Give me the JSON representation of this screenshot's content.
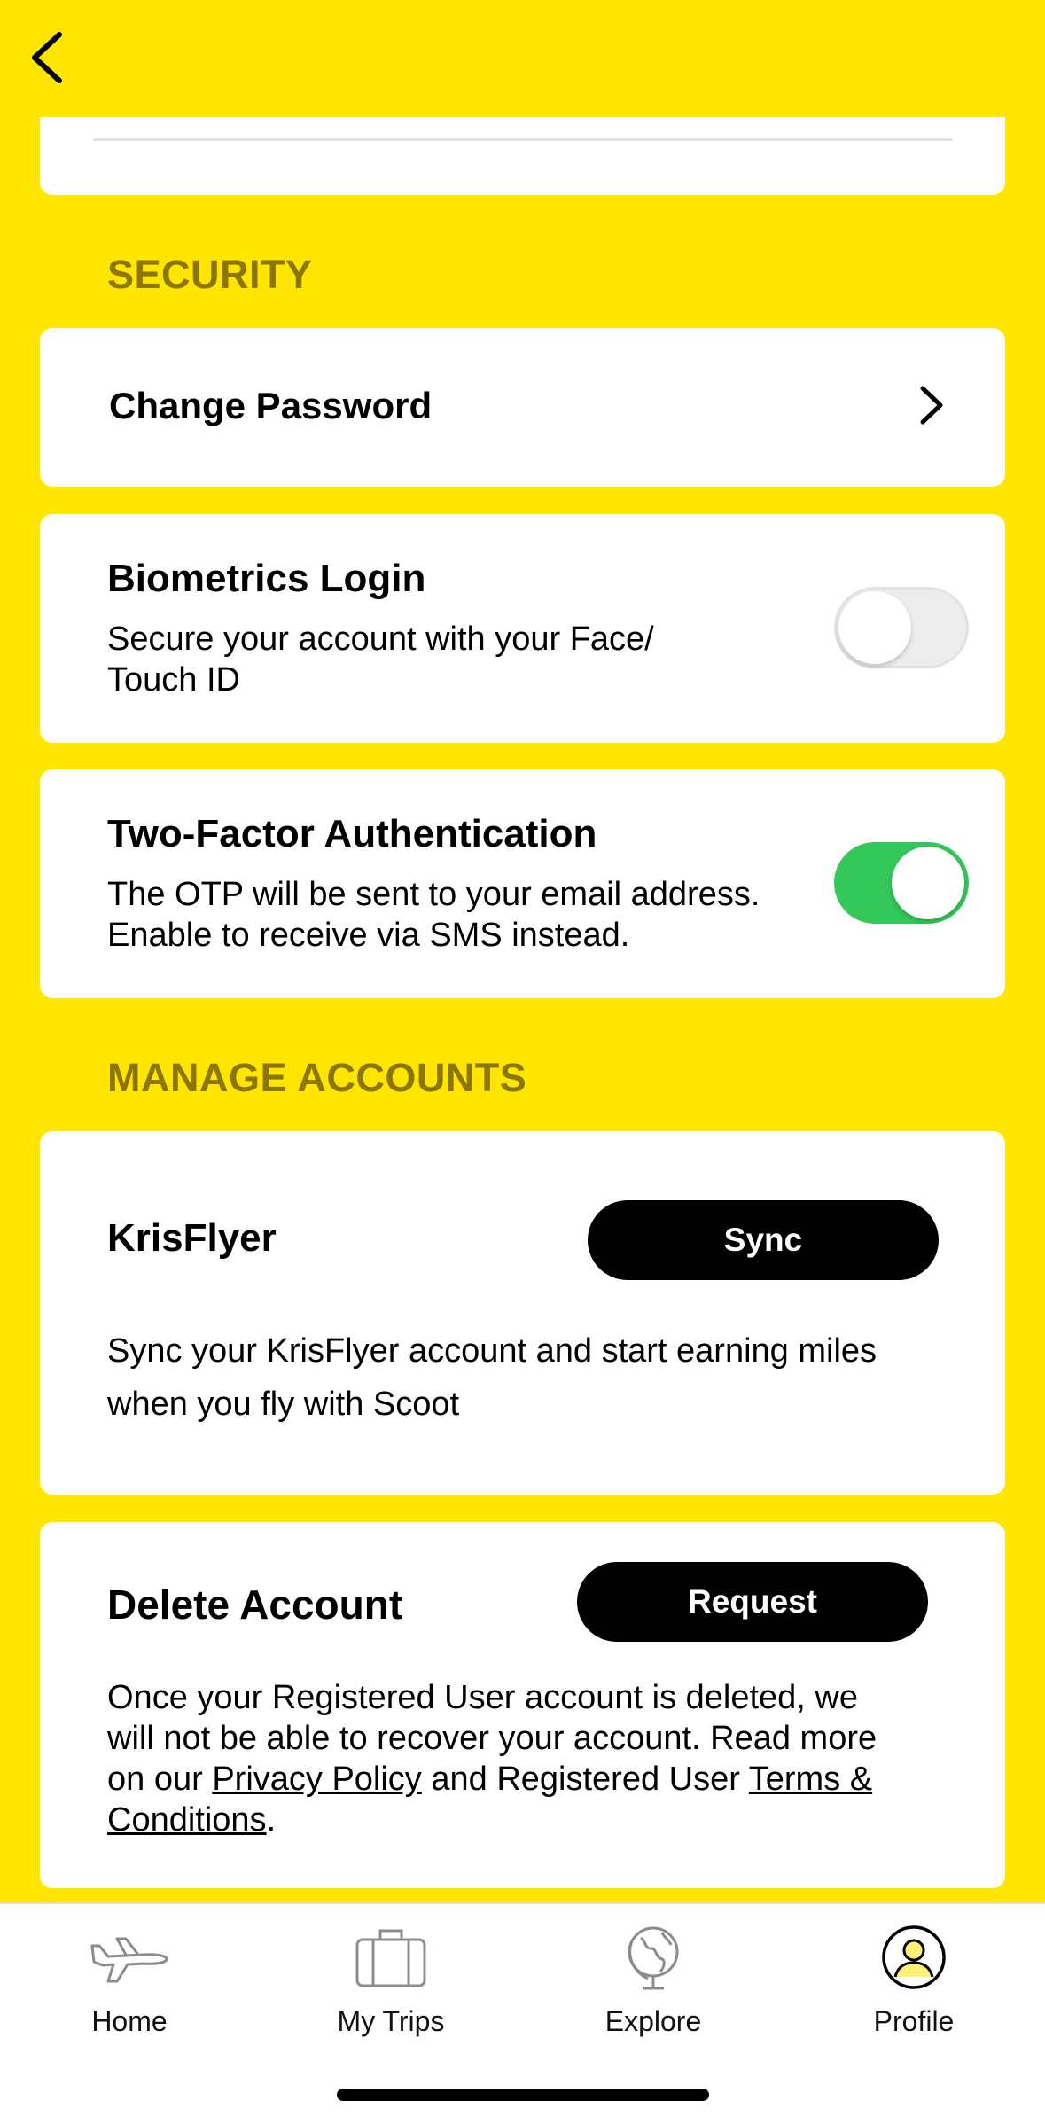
{
  "header": {
    "back_icon": "chevron-left-icon"
  },
  "security": {
    "section_label": "SECURITY",
    "change_password": {
      "label": "Change Password",
      "icon": "chevron-right-icon"
    },
    "biometrics": {
      "title": "Biometrics Login",
      "description_line1": "Secure your account with your Face/",
      "description_line2": "Touch ID",
      "enabled": false
    },
    "two_factor": {
      "title": "Two-Factor Authentication",
      "description_line1": "The OTP will be sent to your email address.",
      "description_line2": "Enable to receive via SMS instead.",
      "enabled": true
    }
  },
  "manage_accounts": {
    "section_label": "MANAGE ACCOUNTS",
    "krisflyer": {
      "title": "KrisFlyer",
      "button_label": "Sync",
      "description_line1": "Sync your KrisFlyer account and start earning miles",
      "description_line2": "when you fly with Scoot"
    },
    "delete_account": {
      "title": "Delete Account",
      "button_label": "Request",
      "description_line1": "Once your Registered User account is deleted, we",
      "description_line2": "will not be able to recover your account. Read more",
      "description_line3_prefix": "on our ",
      "privacy_link": "Privacy Policy",
      "description_line3_middle": " and Registered User ",
      "terms_link_part1": "Terms &",
      "terms_link_part2": "Conditions",
      "description_suffix": "."
    }
  },
  "bottom_nav": {
    "items": [
      {
        "label": "Home",
        "icon": "airplane-icon",
        "active": false
      },
      {
        "label": "My Trips",
        "icon": "suitcase-icon",
        "active": false
      },
      {
        "label": "Explore",
        "icon": "globe-icon",
        "active": false
      },
      {
        "label": "Profile",
        "icon": "profile-icon",
        "active": true
      }
    ]
  },
  "colors": {
    "background": "#FFE500",
    "section_label": "#8A7600",
    "toggle_on": "#34C759",
    "profile_accent": "#FFF07A"
  }
}
